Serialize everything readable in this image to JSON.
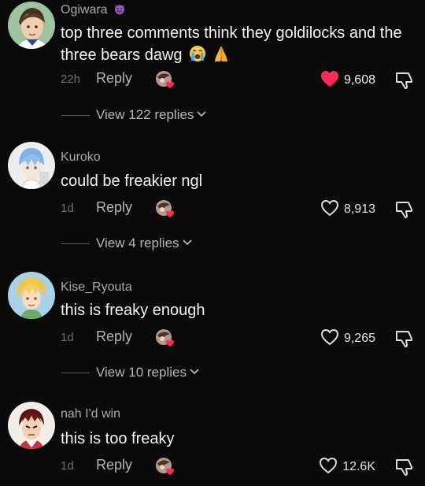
{
  "comments": [
    {
      "username": "Ogiwara",
      "username_badge": "smiling-devil-emoji",
      "text": "top three comments think they goldilocks and the three bears dawg",
      "emojis": [
        "loudly-crying-face-emoji",
        "folded-hands-emoji"
      ],
      "time": "22h",
      "reply_label": "Reply",
      "likes": "9,608",
      "liked": true,
      "view_replies": "View 122 replies"
    },
    {
      "username": "Kuroko",
      "text": "could be freakier ngl",
      "time": "1d",
      "reply_label": "Reply",
      "likes": "8,913",
      "liked": false,
      "view_replies": "View 4 replies"
    },
    {
      "username": "Kise_Ryouta",
      "text": "this is freaky enough",
      "time": "1d",
      "reply_label": "Reply",
      "likes": "9,265",
      "liked": false,
      "view_replies": "View 10 replies"
    },
    {
      "username": "nah I'd win",
      "text": "this is too freaky",
      "time": "1d",
      "reply_label": "Reply",
      "likes": "12.6K",
      "liked": false
    }
  ],
  "colors": {
    "background": "#0a0a0a",
    "like_active": "#fe2c55",
    "secondary_text": "#a9a9a9"
  }
}
